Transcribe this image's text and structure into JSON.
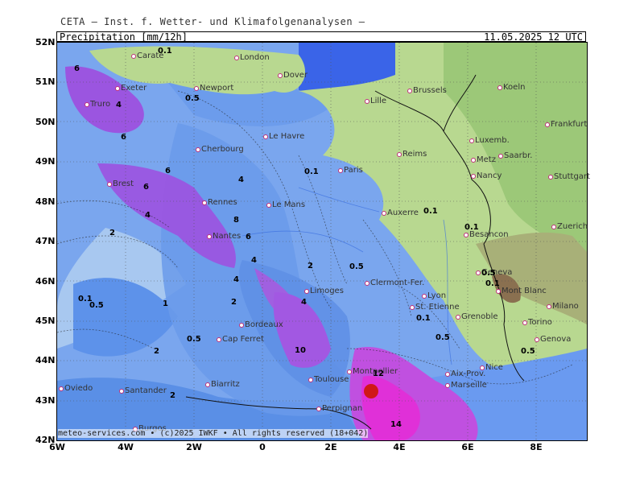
{
  "header": {
    "source": "CETA — Inst. f. Wetter- und Klimafolgenanalysen —"
  },
  "title": {
    "left": "Precipitation [mm/12h]",
    "right": "11.05.2025 12 UTC"
  },
  "footer": {
    "text": "meteo-services.com • (c)2025 IWKF • All rights reserved (18+042)"
  },
  "axes": {
    "y": [
      "52N",
      "51N",
      "50N",
      "49N",
      "48N",
      "47N",
      "46N",
      "45N",
      "44N",
      "43N",
      "42N"
    ],
    "x": [
      "6W",
      "4W",
      "2W",
      "0",
      "2E",
      "4E",
      "6E",
      "8E"
    ]
  },
  "colors": {
    "sea_light": "#a8c8f0",
    "sea_mid": "#5a8fe6",
    "rain_purple": "#9b55e0",
    "rain_magenta": "#e030d8",
    "land": "#b8d890",
    "sea_north": "#3a64e8"
  },
  "cities": [
    "Carate",
    "London",
    "Dover",
    "Exeter",
    "Newport",
    "Truro",
    "Lille",
    "Brussels",
    "Koeln",
    "Frankfurt",
    "Le Havre",
    "Cherbourg",
    "Reims",
    "Luxemb.",
    "Metz",
    "Saarbr.",
    "Paris",
    "Nancy",
    "Stuttgart",
    "Brest",
    "Rennes",
    "Le Mans",
    "Auxerre",
    "Zuerich",
    "Nantes",
    "Besancon",
    "Limoges",
    "Clermont-Fer.",
    "Lyon",
    "Geneva",
    "Mont Blanc",
    "St. Etienne",
    "Grenoble",
    "Milano",
    "Bordeaux",
    "Torino",
    "Cap Ferret",
    "Genova",
    "Nice",
    "Montpellier",
    "Aix-Prov.",
    "Toulouse",
    "Marseille",
    "Biarritz",
    "Oviedo",
    "Santander",
    "Perpignan",
    "Burgos"
  ],
  "contour_labels": [
    "0.1",
    "0.5",
    "6",
    "4",
    "6",
    "6",
    "0.1",
    "4",
    "6",
    "8",
    "4",
    "2",
    "0.1",
    "0.1",
    "6",
    "2",
    "0.5",
    "4",
    "0.5",
    "4",
    "0.1",
    "0.1",
    "0.5",
    "4",
    "2",
    "0.1",
    "1",
    "2",
    "0.5",
    "10",
    "12",
    "14",
    "0.5",
    "0.5",
    "2"
  ]
}
